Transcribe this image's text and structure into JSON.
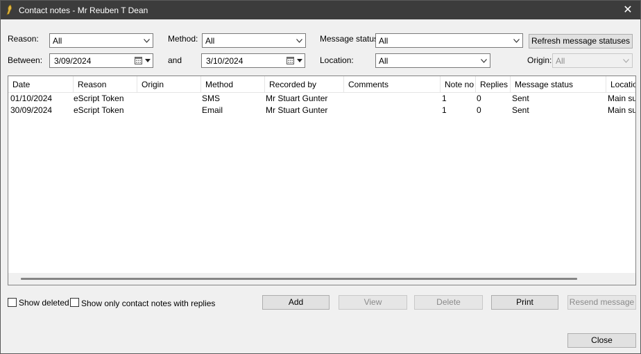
{
  "window": {
    "title": "Contact notes - Mr Reuben T Dean"
  },
  "filters": {
    "reason_label": "Reason:",
    "reason_value": "All",
    "method_label": "Method:",
    "method_value": "All",
    "message_status_label": "Message status:",
    "message_status_value": "All",
    "refresh_button": "Refresh message statuses",
    "between_label": "Between:",
    "between_value": "3/09/2024",
    "and_label": "and",
    "and_value": "3/10/2024",
    "location_label": "Location:",
    "location_value": "All",
    "origin_label": "Origin:",
    "origin_value": "All"
  },
  "table": {
    "columns": [
      "Date",
      "Reason",
      "Origin",
      "Method",
      "Recorded by",
      "Comments",
      "Note no",
      "Replies",
      "Message status",
      "Location"
    ],
    "rows": [
      [
        "01/10/2024",
        "eScript Token",
        "",
        "SMS",
        "Mr Stuart Gunter",
        "",
        "1",
        "0",
        "Sent",
        "Main surgery"
      ],
      [
        "30/09/2024",
        "eScript Token",
        "",
        "Email",
        "Mr Stuart Gunter",
        "",
        "1",
        "0",
        "Sent",
        "Main surgery"
      ]
    ]
  },
  "options": {
    "show_deleted": "Show deleted",
    "show_replies": "Show only contact notes with replies"
  },
  "buttons": {
    "add": "Add",
    "view": "View",
    "delete": "Delete",
    "print": "Print",
    "resend": "Resend message",
    "close": "Close"
  }
}
